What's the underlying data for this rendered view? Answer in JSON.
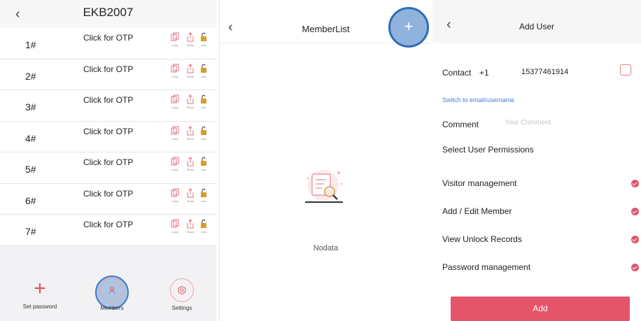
{
  "panel1": {
    "title": "EKB2007",
    "back_icon": "chevron-left-icon",
    "rows": [
      {
        "num": "1#",
        "otp": "Click for OTP"
      },
      {
        "num": "2#",
        "otp": "Click for OTP"
      },
      {
        "num": "3#",
        "otp": "Click for OTP"
      },
      {
        "num": "4#",
        "otp": "Click for OTP"
      },
      {
        "num": "5#",
        "otp": "Click for OTP"
      },
      {
        "num": "6#",
        "otp": "Click for OTP"
      },
      {
        "num": "7#",
        "otp": "Click for OTP"
      }
    ],
    "row_actions": {
      "copy": "Copy",
      "share": "Share",
      "unlock": "unlo"
    },
    "footer": {
      "set_password": "Set password",
      "members": "Members",
      "settings": "Settings"
    },
    "accent": "#e05060"
  },
  "panel2": {
    "title": "MemberList",
    "add_icon": "plus-icon",
    "empty_text": "Nodata",
    "highlight_color": "#2f6db5"
  },
  "panel3": {
    "title": "Add User",
    "contact_label": "Contact",
    "country_code": "+1",
    "contact_number": "15377461914",
    "switch_link": "Switch to email/username",
    "comment_label": "Comment",
    "comment_placeholder": "Your Comment",
    "permissions_heading": "Select User Permissions",
    "permissions": [
      "Visitor management",
      "Add / Edit Member",
      "View Unlock Records",
      "Password management"
    ],
    "add_button": "Add",
    "accent": "#e4546a"
  }
}
